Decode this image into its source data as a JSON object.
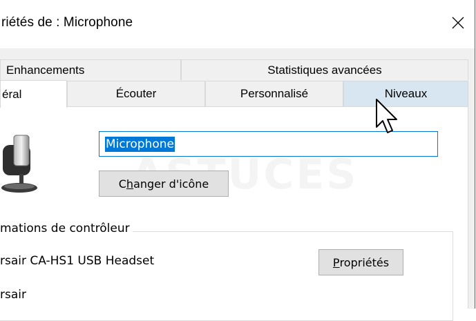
{
  "window": {
    "title": "riétés de : Microphone",
    "close_icon": "close-icon"
  },
  "tabs": {
    "row1": [
      {
        "label": "Enhancements"
      },
      {
        "label": "Statistiques avancées"
      }
    ],
    "row2": [
      {
        "label": "éral",
        "active": true
      },
      {
        "label": "Écouter"
      },
      {
        "label": "Personnalisé"
      },
      {
        "label": "Niveaux",
        "hovered": true
      }
    ]
  },
  "general": {
    "device_icon": "microphone-icon",
    "name_value": "Microphone",
    "change_icon_label_pre": "C",
    "change_icon_label_accel": "h",
    "change_icon_label_post": "anger d'icône",
    "watermark": "ASTUCES",
    "controller_group_label": "mations de contrôleur",
    "controller_name": "rsair CA-HS1 USB Headset",
    "properties_label_accel": "P",
    "properties_label_post": "ropriétés",
    "manufacturer": "rsair"
  },
  "colors": {
    "accent": "#0078d7",
    "hover_tab": "#d8e6f2",
    "dialog_bg": "#f0f0f0"
  }
}
